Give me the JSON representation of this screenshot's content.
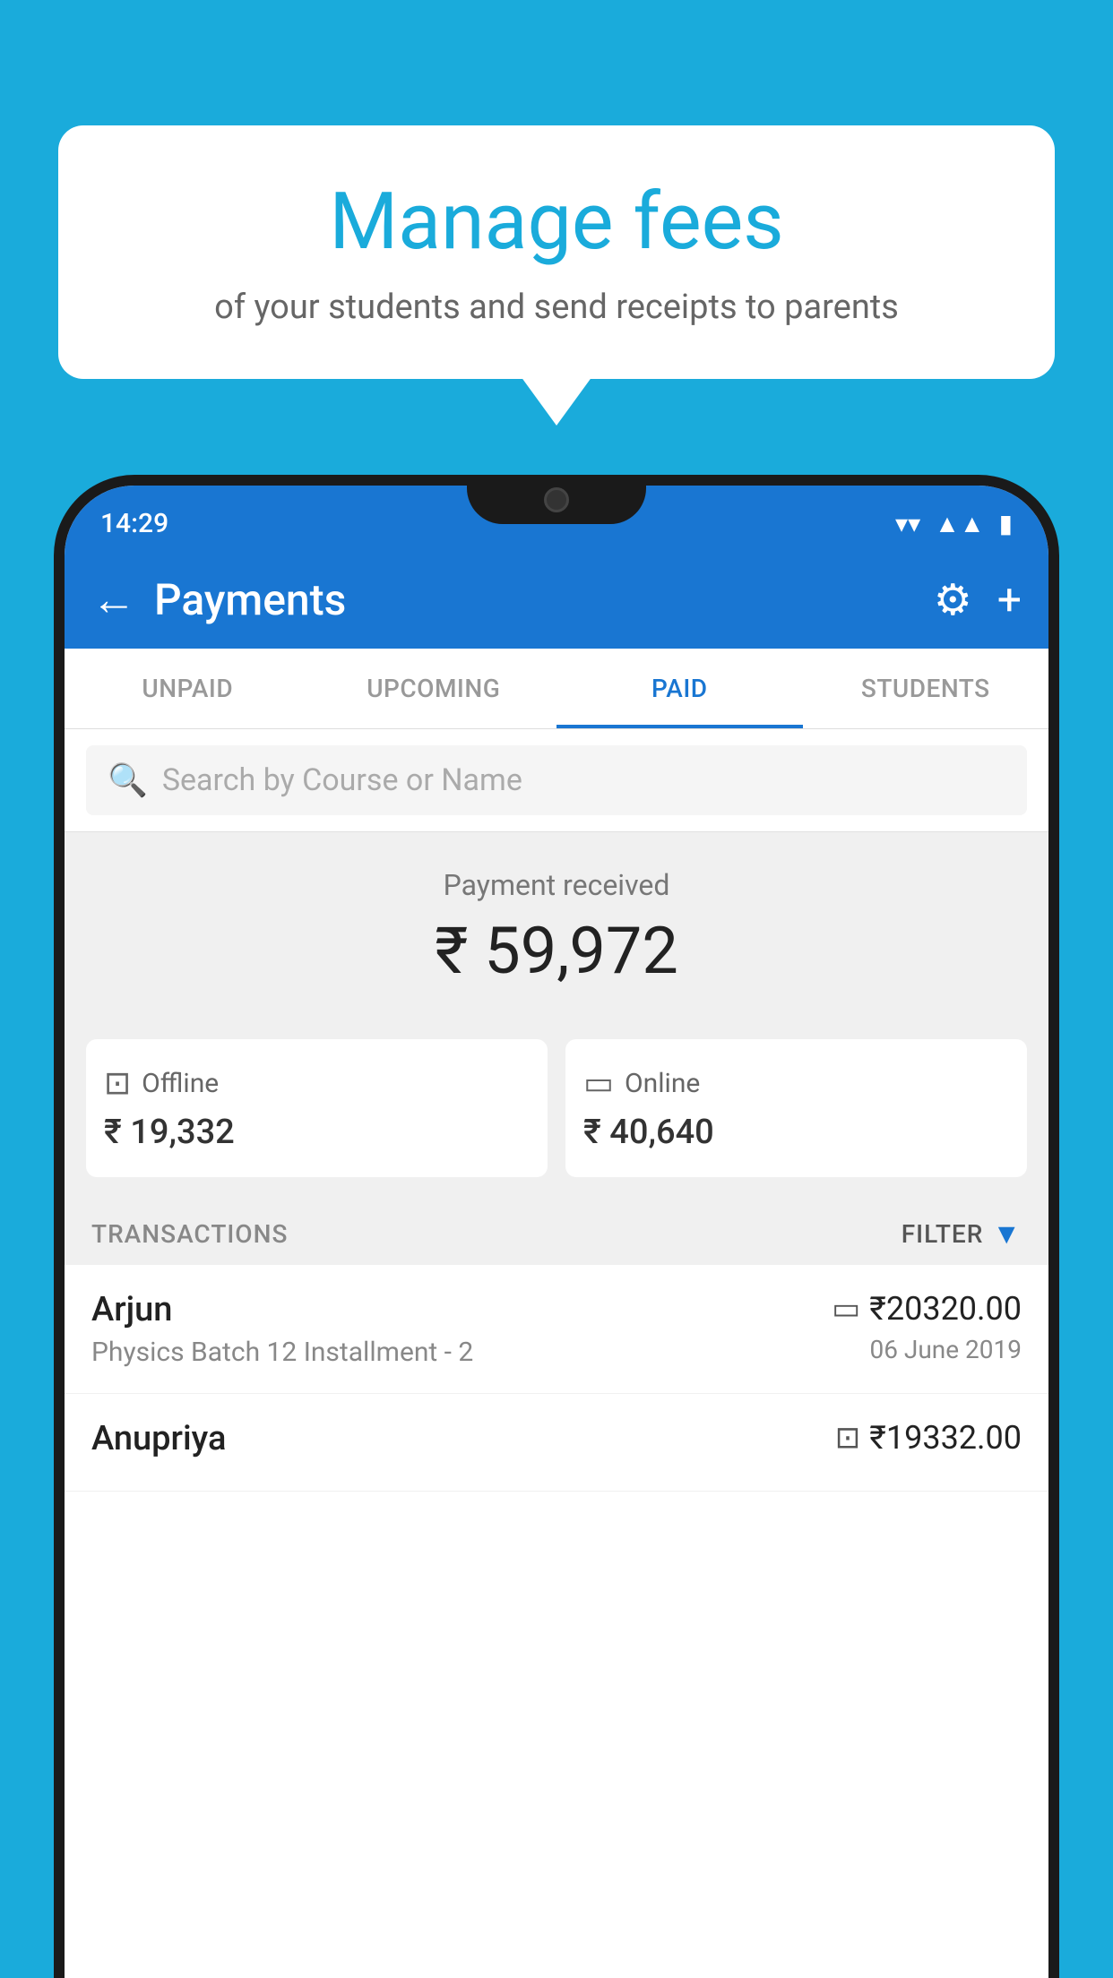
{
  "background_color": "#1AABDB",
  "speech_bubble": {
    "title": "Manage fees",
    "subtitle": "of your students and send receipts to parents"
  },
  "status_bar": {
    "time": "14:29",
    "wifi_icon": "wifi",
    "signal_icon": "signal",
    "battery_icon": "battery"
  },
  "app_bar": {
    "title": "Payments",
    "back_label": "←",
    "gear_label": "⚙",
    "plus_label": "+"
  },
  "tabs": [
    {
      "id": "unpaid",
      "label": "UNPAID",
      "active": false
    },
    {
      "id": "upcoming",
      "label": "UPCOMING",
      "active": false
    },
    {
      "id": "paid",
      "label": "PAID",
      "active": true
    },
    {
      "id": "students",
      "label": "STUDENTS",
      "active": false
    }
  ],
  "search": {
    "placeholder": "Search by Course or Name"
  },
  "payment_summary": {
    "label": "Payment received",
    "amount": "₹ 59,972",
    "offline": {
      "label": "Offline",
      "amount": "₹ 19,332"
    },
    "online": {
      "label": "Online",
      "amount": "₹ 40,640"
    }
  },
  "transactions": {
    "header_label": "TRANSACTIONS",
    "filter_label": "FILTER",
    "items": [
      {
        "name": "Arjun",
        "course": "Physics Batch 12 Installment - 2",
        "amount": "₹20320.00",
        "date": "06 June 2019",
        "payment_type": "card"
      },
      {
        "name": "Anupriya",
        "course": "",
        "amount": "₹19332.00",
        "date": "",
        "payment_type": "cash"
      }
    ]
  }
}
